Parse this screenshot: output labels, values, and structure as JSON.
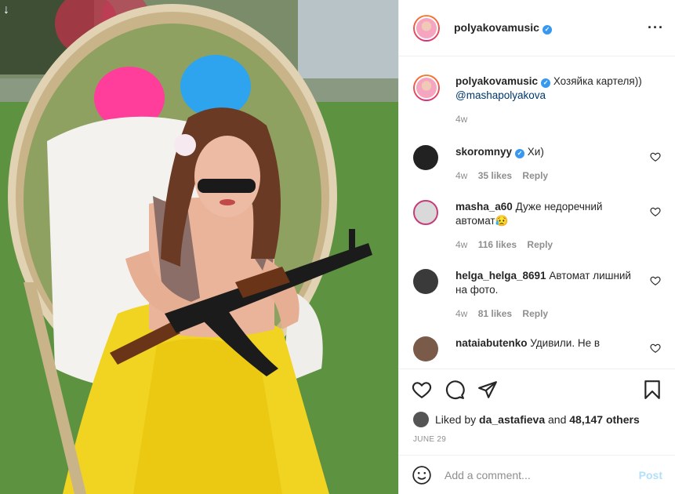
{
  "header": {
    "username": "polyakovamusic",
    "more_icon": "more-horizontal-icon"
  },
  "caption": {
    "username": "polyakovamusic",
    "text": "Хозяйка картеля))",
    "mention": "@mashapolyakova",
    "time": "4w"
  },
  "comments": [
    {
      "username": "skoromnyy",
      "verified": true,
      "text": "Хи)",
      "time": "4w",
      "likes": "35 likes",
      "reply": "Reply"
    },
    {
      "username": "masha_a60",
      "verified": false,
      "text": "Дуже недоречний автомат😥",
      "time": "4w",
      "likes": "116 likes",
      "reply": "Reply"
    },
    {
      "username": "helga_helga_8691",
      "verified": false,
      "text": "Автомат лишний на фото.",
      "time": "4w",
      "likes": "81 likes",
      "reply": "Reply"
    },
    {
      "username": "nataiabutenko",
      "verified": false,
      "text": "Удивили. Не в",
      "time": "",
      "likes": "",
      "reply": ""
    }
  ],
  "likes": {
    "prefix": "Liked by",
    "user": "da_astafieva",
    "and": "and",
    "others": "48,147 others"
  },
  "date": "JUNE 29",
  "add_comment": {
    "placeholder": "Add a comment...",
    "post_label": "Post"
  },
  "photo": {
    "corner_arrow": "↓"
  },
  "colors": {
    "verified": "#3897f0",
    "link": "#00376b",
    "post_disabled": "#b2dffc",
    "muted": "#8e8e8e"
  }
}
